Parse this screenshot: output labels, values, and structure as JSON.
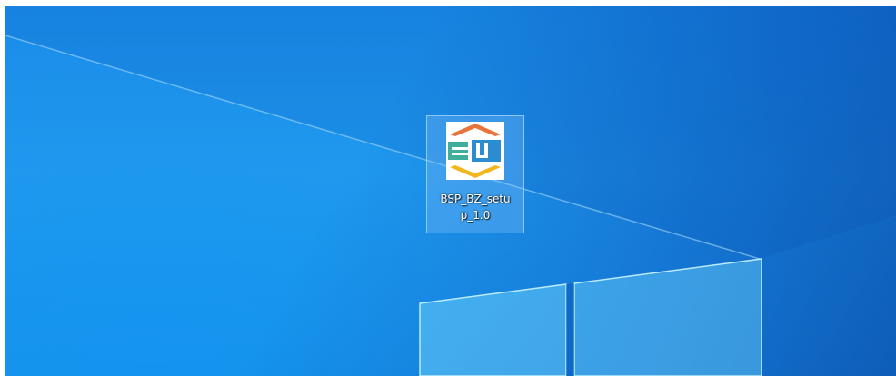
{
  "desktop": {
    "icons": [
      {
        "label_line1": "BSP_BZ_setu",
        "label_line2": "p_1.0",
        "icon": "bsp-installer-icon",
        "selected": true
      }
    ]
  },
  "colors": {
    "wallpaper_blue": "#1592ea",
    "icon_orange": "#e8743b",
    "icon_yellow": "#f2b61d",
    "icon_teal": "#2b8ccf"
  }
}
